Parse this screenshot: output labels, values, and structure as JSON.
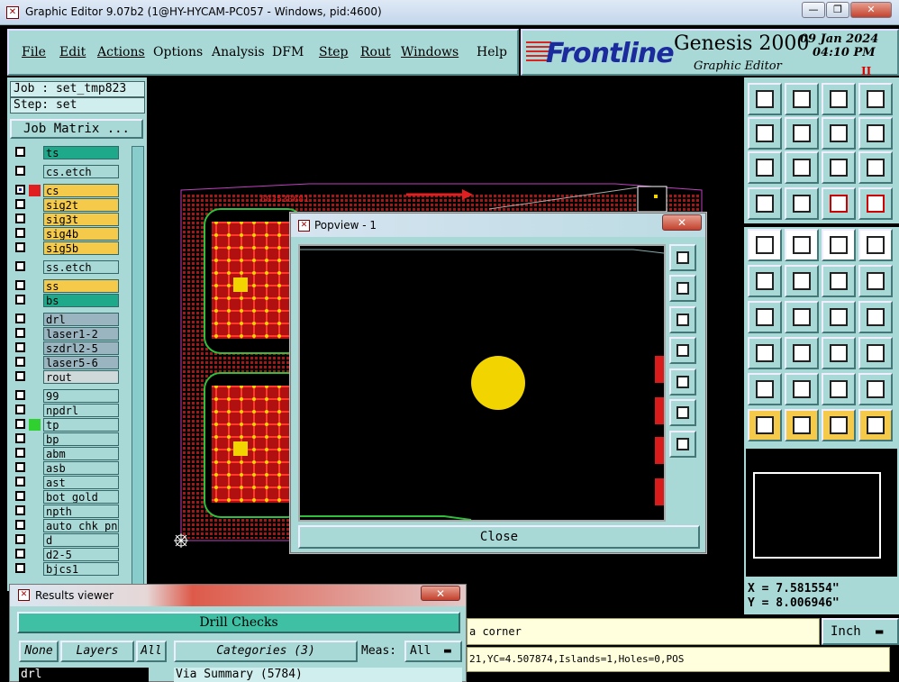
{
  "window": {
    "title": "Graphic Editor 9.07b2 (1@HY-HYCAM-PC057 - Windows, pid:4600)",
    "app_icon": "x-logo-icon"
  },
  "menu": {
    "items": [
      "File",
      "Edit",
      "Actions",
      "Options",
      "Analysis",
      "DFM",
      "Step",
      "Rout",
      "Windows",
      "Help"
    ]
  },
  "brand": {
    "logo": "Frontline",
    "product": "Genesis 2000",
    "subtitle": "Graphic Editor",
    "date": "09 Jan 2024",
    "time": "04:10 PM",
    "pause": "II"
  },
  "job": {
    "job_label": "Job : set_tmp823",
    "step_label": "Step: set",
    "matrix_button": "Job Matrix ..."
  },
  "layers": [
    {
      "name": "ts",
      "color": "#1fa98b",
      "chk": false
    },
    {
      "name": "cs.etch",
      "color": "#a9d9d6",
      "chk": false
    },
    {
      "name": "cs",
      "color": "#f5c94a",
      "chk": true,
      "active": true
    },
    {
      "name": "sig2t",
      "color": "#f5c94a",
      "chk": false
    },
    {
      "name": "sig3t",
      "color": "#f5c94a",
      "chk": false
    },
    {
      "name": "sig4b",
      "color": "#f5c94a",
      "chk": false
    },
    {
      "name": "sig5b",
      "color": "#f5c94a",
      "chk": false
    },
    {
      "name": "ss.etch",
      "color": "#a9d9d6",
      "chk": false
    },
    {
      "name": "ss",
      "color": "#f5c94a",
      "chk": false
    },
    {
      "name": "bs",
      "color": "#1fa98b",
      "chk": false
    },
    {
      "name": "drl",
      "color": "#9ab5c0",
      "chk": false
    },
    {
      "name": "laser1-2",
      "color": "#9ab5c0",
      "chk": false
    },
    {
      "name": "szdrl2-5",
      "color": "#9ab5c0",
      "chk": false
    },
    {
      "name": "laser5-6",
      "color": "#9ab5c0",
      "chk": false
    },
    {
      "name": "rout",
      "color": "#cfd9d9",
      "chk": false
    },
    {
      "name": "99",
      "color": "#a9d9d6",
      "chk": false
    },
    {
      "name": "npdrl",
      "color": "#a9d9d6",
      "chk": false
    },
    {
      "name": "tp",
      "color": "#a9d9d6",
      "chk": false,
      "green": true
    },
    {
      "name": "bp",
      "color": "#a9d9d6",
      "chk": false
    },
    {
      "name": "abm",
      "color": "#a9d9d6",
      "chk": false
    },
    {
      "name": "asb",
      "color": "#a9d9d6",
      "chk": false
    },
    {
      "name": "ast",
      "color": "#a9d9d6",
      "chk": false
    },
    {
      "name": "bot_gold",
      "color": "#a9d9d6",
      "chk": false
    },
    {
      "name": "npth",
      "color": "#a9d9d6",
      "chk": false
    },
    {
      "name": "auto_chk_pn",
      "color": "#a9d9d6",
      "chk": false
    },
    {
      "name": "d",
      "color": "#a9d9d6",
      "chk": false
    },
    {
      "name": "d2-5",
      "color": "#a9d9d6",
      "chk": false
    },
    {
      "name": "bjcs1",
      "color": "#a9d9d6",
      "chk": false
    }
  ],
  "canvas": {
    "board_label": "603530681"
  },
  "popview": {
    "title": "Popview - 1",
    "close_label": "Close"
  },
  "coords": {
    "x": "X = 7.581554\"",
    "y": "Y = 8.006946\""
  },
  "status": {
    "message": "a corner",
    "units": "Inch",
    "info": "21,YC=4.507874,Islands=1,Holes=0,POS"
  },
  "results": {
    "title": "Results viewer",
    "header": "Drill Checks",
    "none": "None",
    "layers": "Layers",
    "all": "All",
    "categories": "Categories (3)",
    "meas_label": "Meas:",
    "meas_value": "All",
    "layer_selected": "drl",
    "category_item": "Via Summary (5784)"
  },
  "colors": {
    "panel": "#a9d9d6",
    "accent_yellow": "#f5c94a",
    "accent_green": "#1fa98b",
    "pcb_red": "#d81b1b",
    "pad_yellow": "#f2d400"
  }
}
